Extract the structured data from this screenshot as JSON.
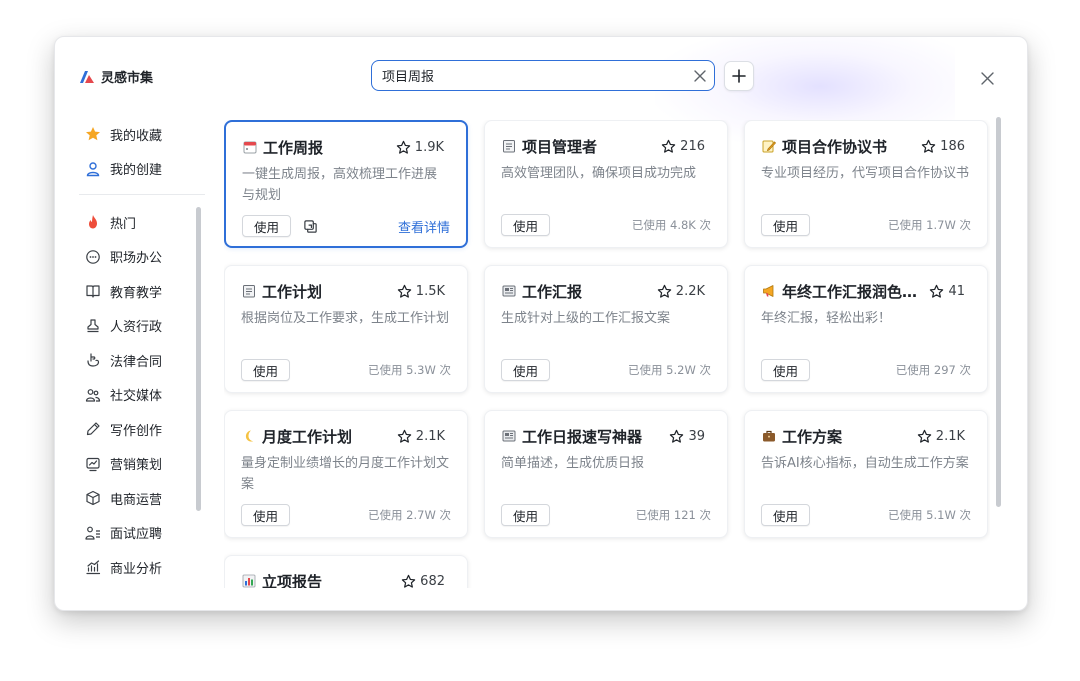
{
  "brand": {
    "name": "灵感市集",
    "logo_icon": "brand-logo-icon",
    "accent": "#2f6fd8"
  },
  "search": {
    "value": "项目周报",
    "placeholder": ""
  },
  "sidebar": {
    "top_items": [
      {
        "label": "我的收藏",
        "icon": "star-icon"
      },
      {
        "label": "我的创建",
        "icon": "user-icon"
      }
    ],
    "categories": [
      {
        "label": "热门",
        "icon": "fire-icon"
      },
      {
        "label": "职场办公",
        "icon": "chat-icon"
      },
      {
        "label": "教育教学",
        "icon": "book-icon"
      },
      {
        "label": "人资行政",
        "icon": "stamp-icon"
      },
      {
        "label": "法律合同",
        "icon": "hand-icon"
      },
      {
        "label": "社交媒体",
        "icon": "people-icon"
      },
      {
        "label": "写作创作",
        "icon": "pen-icon"
      },
      {
        "label": "营销策划",
        "icon": "trend-icon"
      },
      {
        "label": "电商运营",
        "icon": "box-icon"
      },
      {
        "label": "面试应聘",
        "icon": "person-list-icon"
      },
      {
        "label": "商业分析",
        "icon": "chart-icon"
      }
    ]
  },
  "cards": [
    {
      "emoji": "calendar",
      "title": "工作周报",
      "stars": "1.9K",
      "desc": "一键生成周报，高效梳理工作进展与规划",
      "use_label": "使用",
      "detail_label": "查看详情",
      "selected": true
    },
    {
      "emoji": "clipboard",
      "title": "项目管理者",
      "stars": "216",
      "desc": "高效管理团队，确保项目成功完成",
      "use_label": "使用",
      "used": "已使用 4.8K 次"
    },
    {
      "emoji": "memo",
      "title": "项目合作协议书",
      "stars": "186",
      "desc": "专业项目经历，代写项目合作协议书",
      "use_label": "使用",
      "used": "已使用 1.7W 次"
    },
    {
      "emoji": "clipboard",
      "title": "工作计划",
      "stars": "1.5K",
      "desc": "根据岗位及工作要求，生成工作计划",
      "use_label": "使用",
      "used": "已使用 5.3W 次"
    },
    {
      "emoji": "newspaper",
      "title": "工作汇报",
      "stars": "2.2K",
      "desc": "生成针对上级的工作汇报文案",
      "use_label": "使用",
      "used": "已使用 5.2W 次"
    },
    {
      "emoji": "megaphone",
      "title": "年终工作汇报润色…",
      "stars": "41",
      "desc": "年终汇报，轻松出彩！",
      "use_label": "使用",
      "used": "已使用 297 次"
    },
    {
      "emoji": "moon",
      "title": "月度工作计划",
      "stars": "2.1K",
      "desc": "量身定制业绩增长的月度工作计划文案",
      "use_label": "使用",
      "used": "已使用 2.7W 次"
    },
    {
      "emoji": "newspaper",
      "title": "工作日报速写神器",
      "stars": "39",
      "desc": "简单描述，生成优质日报",
      "use_label": "使用",
      "used": "已使用 121 次"
    },
    {
      "emoji": "briefcase",
      "title": "工作方案",
      "stars": "2.1K",
      "desc": "告诉AI核心指标，自动生成工作方案",
      "use_label": "使用",
      "used": "已使用 5.1W 次"
    },
    {
      "emoji": "bar-chart",
      "title": "立项报告",
      "stars": "682",
      "desc": "",
      "use_label": "",
      "used": ""
    }
  ]
}
